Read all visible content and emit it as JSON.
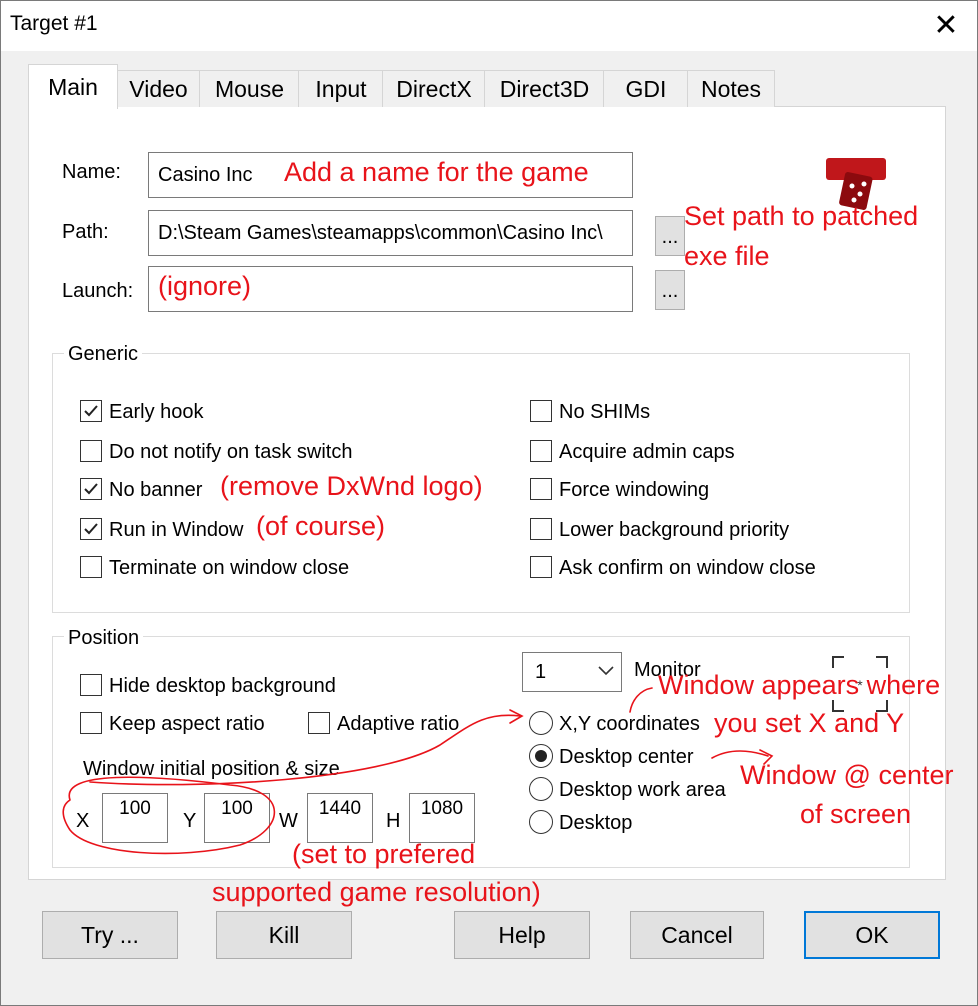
{
  "window": {
    "title": "Target #1"
  },
  "tabs": [
    "Main",
    "Video",
    "Mouse",
    "Input",
    "DirectX",
    "Direct3D",
    "GDI",
    "Notes"
  ],
  "fields": {
    "name_label": "Name:",
    "name_value": "Casino Inc",
    "path_label": "Path:",
    "path_value": "D:\\Steam Games\\steamapps\\common\\Casino Inc\\",
    "launch_label": "Launch:",
    "launch_value": "",
    "browse_label": "..."
  },
  "generic": {
    "title": "Generic",
    "left": [
      {
        "label": "Early hook",
        "checked": true
      },
      {
        "label": "Do not notify on task switch",
        "checked": false
      },
      {
        "label": "No banner",
        "checked": true
      },
      {
        "label": "Run in Window",
        "checked": true
      },
      {
        "label": "Terminate on window close",
        "checked": false
      }
    ],
    "right": [
      {
        "label": "No SHIMs",
        "checked": false
      },
      {
        "label": "Acquire admin caps",
        "checked": false
      },
      {
        "label": "Force windowing",
        "checked": false
      },
      {
        "label": "Lower background priority",
        "checked": false
      },
      {
        "label": "Ask confirm on window close",
        "checked": false
      }
    ]
  },
  "position": {
    "title": "Position",
    "hide_desktop": "Hide desktop background",
    "keep_aspect": "Keep aspect ratio",
    "adaptive": "Adaptive ratio",
    "monitor_value": "1",
    "monitor_label": "Monitor",
    "radios": [
      {
        "label": "X,Y coordinates",
        "selected": false
      },
      {
        "label": "Desktop center",
        "selected": true
      },
      {
        "label": "Desktop work area",
        "selected": false
      },
      {
        "label": "Desktop",
        "selected": false
      }
    ],
    "initial_label": "Window initial position & size",
    "x_label": "X",
    "x_value": "100",
    "y_label": "Y",
    "y_value": "100",
    "w_label": "W",
    "w_value": "1440",
    "h_label": "H",
    "h_value": "1080"
  },
  "buttons": {
    "try": "Try ...",
    "kill": "Kill",
    "help": "Help",
    "cancel": "Cancel",
    "ok": "OK"
  },
  "annotations": {
    "name": "Add a name for the game",
    "path_1": "Set path to patched",
    "path_2": "exe file",
    "launch": "(ignore)",
    "no_banner": "(remove DxWnd logo)",
    "run_window": "(of course)",
    "xy_1": "Window appears where",
    "xy_2": "you set X and Y",
    "center_1": "Window @ center",
    "center_2": "of screen",
    "res_1": "(set to prefered",
    "res_2": "supported game resolution)"
  },
  "colors": {
    "annotation": "#e8131a",
    "accent": "#0078d7"
  }
}
